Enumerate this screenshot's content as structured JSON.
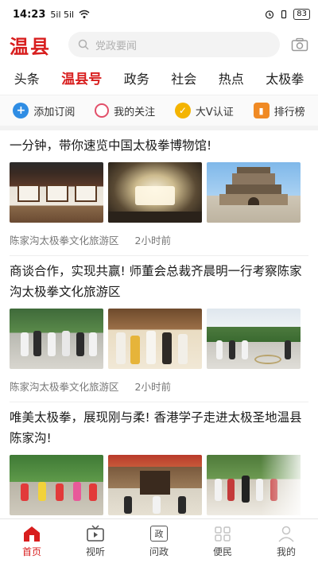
{
  "status": {
    "time": "14:23",
    "signal": "5il 5il",
    "battery": "83"
  },
  "header": {
    "logo": "温县",
    "search_placeholder": "党政要闻"
  },
  "channels": [
    {
      "label": "头条"
    },
    {
      "label": "温县号"
    },
    {
      "label": "政务"
    },
    {
      "label": "社会"
    },
    {
      "label": "热点"
    },
    {
      "label": "太极拳"
    }
  ],
  "shortcuts": [
    {
      "label": "添加订阅",
      "icon": "plus-icon",
      "color": "#2f8de4"
    },
    {
      "label": "我的关注",
      "icon": "circle-icon",
      "color": "#e2506a"
    },
    {
      "label": "大V认证",
      "icon": "check-badge-icon",
      "color": "#f4b400"
    },
    {
      "label": "排行榜",
      "icon": "ranking-icon",
      "color": "#f08a24"
    }
  ],
  "articles": [
    {
      "title": "一分钟，带你速览中国太极拳博物馆!",
      "source": "陈家沟太极拳文化旅游区",
      "time": "2小时前"
    },
    {
      "title": "商谈合作，实现共赢! 师董会总裁齐晨明一行考察陈家沟太极拳文化旅游区",
      "source": "陈家沟太极拳文化旅游区",
      "time": "2小时前"
    },
    {
      "title": "唯美太极拳，展现刚与柔! 香港学子走进太极圣地温县陈家沟!",
      "source": "",
      "time": ""
    }
  ],
  "tabbar": [
    {
      "label": "首页",
      "icon": "home-icon"
    },
    {
      "label": "视听",
      "icon": "tv-icon"
    },
    {
      "label": "问政",
      "icon": "gov-icon",
      "glyph": "政"
    },
    {
      "label": "便民",
      "icon": "service-icon"
    },
    {
      "label": "我的",
      "icon": "profile-icon"
    }
  ],
  "colors": {
    "brand": "#d81e1e",
    "muted": "#777777"
  }
}
